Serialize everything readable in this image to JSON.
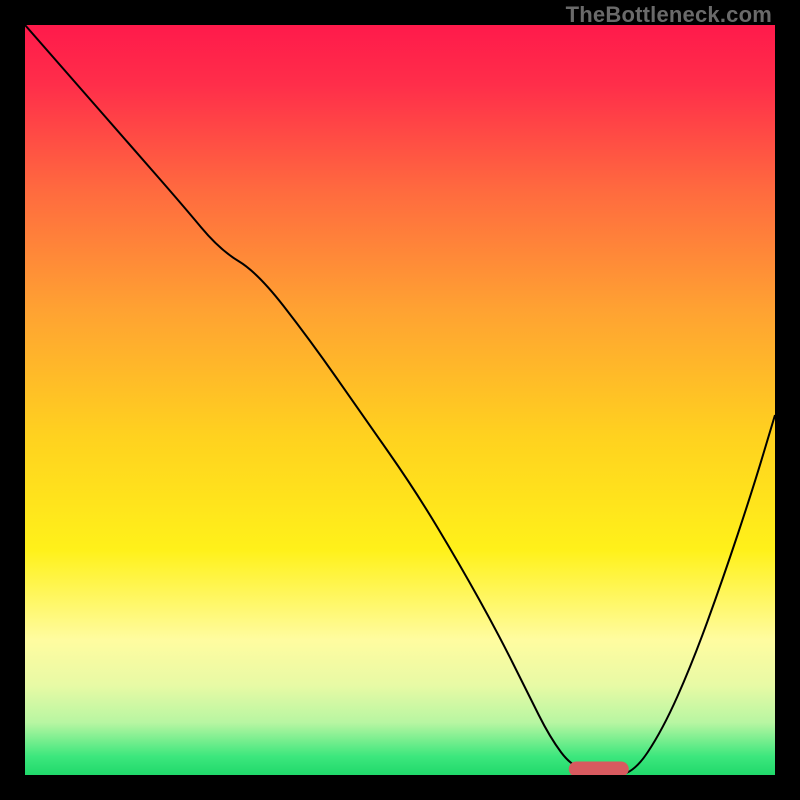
{
  "watermark": "TheBottleneck.com",
  "chart_data": {
    "type": "line",
    "title": "",
    "xlabel": "",
    "ylabel": "",
    "xlim": [
      0,
      100
    ],
    "ylim": [
      0,
      100
    ],
    "grid": false,
    "background_gradient": {
      "stops": [
        {
          "offset": 0.0,
          "color": "#ff1a4b"
        },
        {
          "offset": 0.08,
          "color": "#ff2e4a"
        },
        {
          "offset": 0.22,
          "color": "#ff6a3f"
        },
        {
          "offset": 0.38,
          "color": "#ffa232"
        },
        {
          "offset": 0.55,
          "color": "#ffd21f"
        },
        {
          "offset": 0.7,
          "color": "#fff11a"
        },
        {
          "offset": 0.82,
          "color": "#fffca0"
        },
        {
          "offset": 0.88,
          "color": "#e8faa5"
        },
        {
          "offset": 0.93,
          "color": "#b8f6a2"
        },
        {
          "offset": 0.975,
          "color": "#3de77d"
        },
        {
          "offset": 1.0,
          "color": "#20d96b"
        }
      ]
    },
    "series": [
      {
        "name": "bottleneck-curve",
        "stroke": "#000000",
        "stroke_width": 2,
        "x": [
          0,
          7,
          14,
          21,
          26,
          31,
          38,
          45,
          52,
          58,
          63,
          67,
          70,
          73,
          77,
          81,
          85,
          89,
          93,
          97,
          100
        ],
        "values": [
          100,
          92,
          84,
          76,
          70,
          67,
          58,
          48,
          38,
          28,
          19,
          11,
          5,
          1,
          0,
          0,
          6,
          15,
          26,
          38,
          48
        ]
      }
    ],
    "marker": {
      "name": "optimal-range",
      "shape": "rounded-bar",
      "color": "#d85a5f",
      "x_start": 72.5,
      "x_end": 80.5,
      "y": 0.8,
      "height": 2.0
    }
  }
}
